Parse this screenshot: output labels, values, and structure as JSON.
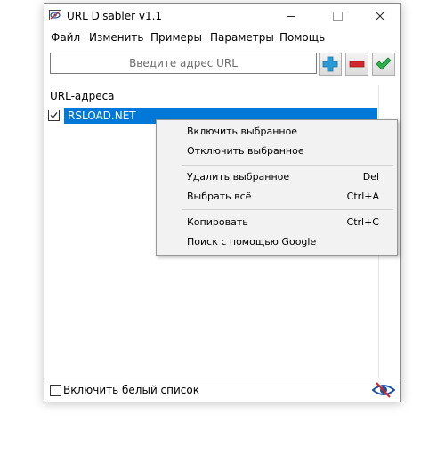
{
  "window": {
    "title": "URL Disabler v1.1"
  },
  "menubar": {
    "items": [
      "Файл",
      "Изменить",
      "Примеры",
      "Параметры",
      "Помощь"
    ]
  },
  "toolbar": {
    "url_placeholder": "Введите адрес URL",
    "url_value": "",
    "add_icon": "plus-icon",
    "remove_icon": "minus-icon",
    "apply_icon": "checkmark-icon",
    "colors": {
      "add": "#2b9bd6",
      "remove": "#d3262c",
      "apply": "#2bb24c"
    }
  },
  "list": {
    "header": "URL-адреса",
    "rows": [
      {
        "checked": true,
        "label": "RSLOAD.NET",
        "selected": true
      }
    ],
    "selection_color": "#0078d7"
  },
  "status": {
    "whitelist_checked": false,
    "whitelist_label": "Включить белый список",
    "eye_icon": "eye-disabled-icon"
  },
  "context_menu": {
    "groups": [
      [
        {
          "label": "Включить выбранное",
          "shortcut": ""
        },
        {
          "label": "Отключить выбранное",
          "shortcut": ""
        }
      ],
      [
        {
          "label": "Удалить выбранное",
          "shortcut": "Del"
        },
        {
          "label": "Выбрать всё",
          "shortcut": "Ctrl+A"
        }
      ],
      [
        {
          "label": "Копировать",
          "shortcut": "Ctrl+C"
        },
        {
          "label": "Поиск с помощью Google",
          "shortcut": ""
        }
      ]
    ]
  }
}
